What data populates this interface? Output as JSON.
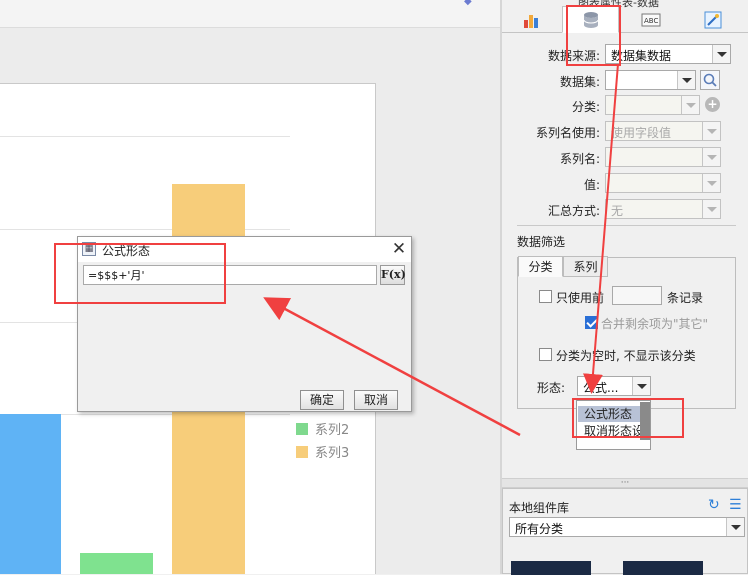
{
  "canvas": {
    "legend": [
      {
        "name": "系列2",
        "color": "#7fd98e"
      },
      {
        "name": "系列3",
        "color": "#f7cd7a"
      }
    ],
    "bar_colors": {
      "blue": "#5fb3f5",
      "green": "#7fe28f",
      "yellow": "#f7cd7a"
    }
  },
  "dialog": {
    "title": "公式形态",
    "formula_value": "=$$$+'月'",
    "fx_label": "F(x)",
    "ok_label": "确定",
    "cancel_label": "取消",
    "close_symbol": "✕"
  },
  "panel": {
    "header_text": "图表属性表-数据",
    "tabs": [
      {
        "name": "chart-type",
        "icon": "bar-chart-icon"
      },
      {
        "name": "data",
        "icon": "database-icon"
      },
      {
        "name": "style",
        "icon": "abc-style-icon"
      },
      {
        "name": "effect",
        "icon": "effect-icon"
      }
    ],
    "fields": {
      "data_source_label": "数据来源:",
      "data_source_value": "数据集数据",
      "dataset_label": "数据集:",
      "dataset_value": "",
      "category_label": "分类:",
      "category_value": "",
      "series_name_use_label": "系列名使用:",
      "series_name_use_value": "使用字段值",
      "series_name_label": "系列名:",
      "series_name_value": "",
      "value_label": "值:",
      "value_value": "",
      "summary_label": "汇总方式:",
      "summary_value": "无"
    },
    "filter": {
      "title": "数据筛选",
      "tab_category": "分类",
      "tab_series": "系列",
      "only_use_front": "只使用前",
      "records_suffix": "条记录",
      "merge_rest": "合并剩余项为\"其它\"",
      "hide_empty": "分类为空时, 不显示该分类",
      "shape_label": "形态:",
      "shape_value": "公式..."
    },
    "dropdown_options": [
      "公式形态",
      "取消形态设"
    ]
  },
  "library": {
    "title": "本地组件库",
    "category_value": "所有分类"
  },
  "annotation_color": "#f04040"
}
